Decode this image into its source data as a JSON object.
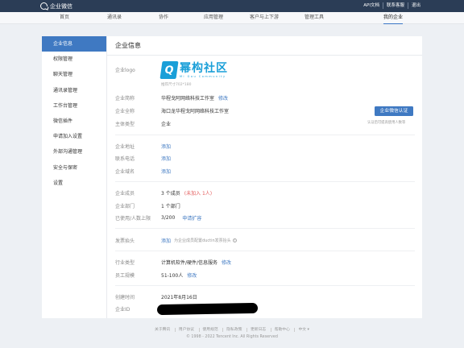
{
  "app": {
    "name": "企业微信"
  },
  "top_links": [
    "API文档",
    "联系客服",
    "退出"
  ],
  "nav": {
    "tabs": [
      {
        "label": "首页"
      },
      {
        "label": "通讯录"
      },
      {
        "label": "协作"
      },
      {
        "label": "应用管理"
      },
      {
        "label": "客户与上下游"
      },
      {
        "label": "管理工具"
      },
      {
        "label": "我的企业",
        "active": true
      }
    ]
  },
  "sidebar": {
    "items": [
      {
        "label": "企业信息",
        "active": true
      },
      {
        "label": "权限管理"
      },
      {
        "label": "聊天管理"
      },
      {
        "label": "通讯录管理"
      },
      {
        "label": "工作台管理"
      },
      {
        "label": "微信插件"
      },
      {
        "label": "申请加入设置"
      },
      {
        "label": "外部沟通管理"
      },
      {
        "label": "安全与保密"
      },
      {
        "label": "设置"
      }
    ]
  },
  "main": {
    "title": "企业信息",
    "logo": {
      "label": "企业logo",
      "mark": "Q",
      "text_cn": "幂构社区",
      "text_en": "Mi Gou Community",
      "hint": "推荐尺寸702*180"
    },
    "short_name": {
      "label": "企业简称",
      "value": "华程戈阿网络科技工作室",
      "action": "修改"
    },
    "full_name": {
      "label": "企业全称",
      "value": "海口龙华程戈阿网络科技工作室"
    },
    "verify_button": "企业微信认证",
    "verify_hint": "认证后可提高使用人数等",
    "subject_type": {
      "label": "主体类型",
      "value": "企业"
    },
    "address": {
      "label": "企业地址",
      "action": "添加"
    },
    "phone": {
      "label": "联系电话",
      "action": "添加"
    },
    "domain": {
      "label": "企业域名",
      "action": "添加"
    },
    "members": {
      "label": "企业成员",
      "value": "3 个成员",
      "warning": "(未加入 1人)"
    },
    "departments": {
      "label": "企业部门",
      "value": "1 个部门"
    },
    "capacity": {
      "label": "已使用/人数上限",
      "value": "3/200",
      "action": "申请扩容"
    },
    "invoice": {
      "label": "发票抬头",
      "action": "添加",
      "hint": "为企业成员配置ductin发票抬头"
    },
    "industry": {
      "label": "行业类型",
      "value": "计算机软件/硬件/信息服务",
      "action": "修改"
    },
    "scale": {
      "label": "员工规模",
      "value": "51-100人",
      "action": "修改"
    },
    "created": {
      "label": "创建时间",
      "value": "2021年8月16日"
    },
    "corp_id": {
      "label": "企业ID"
    }
  },
  "footer": {
    "links": [
      "关于腾讯",
      "用户协议",
      "使用规范",
      "隐私政策",
      "更新日志",
      "帮助中心",
      "中文 ▾"
    ],
    "copyright": "© 1998 - 2022 Tencent Inc. All Rights Reserved"
  },
  "colors": {
    "topbar": "#2b3d56",
    "accent": "#3f79c2",
    "warning": "#e35b5b",
    "logo": "#1a9fd8"
  }
}
